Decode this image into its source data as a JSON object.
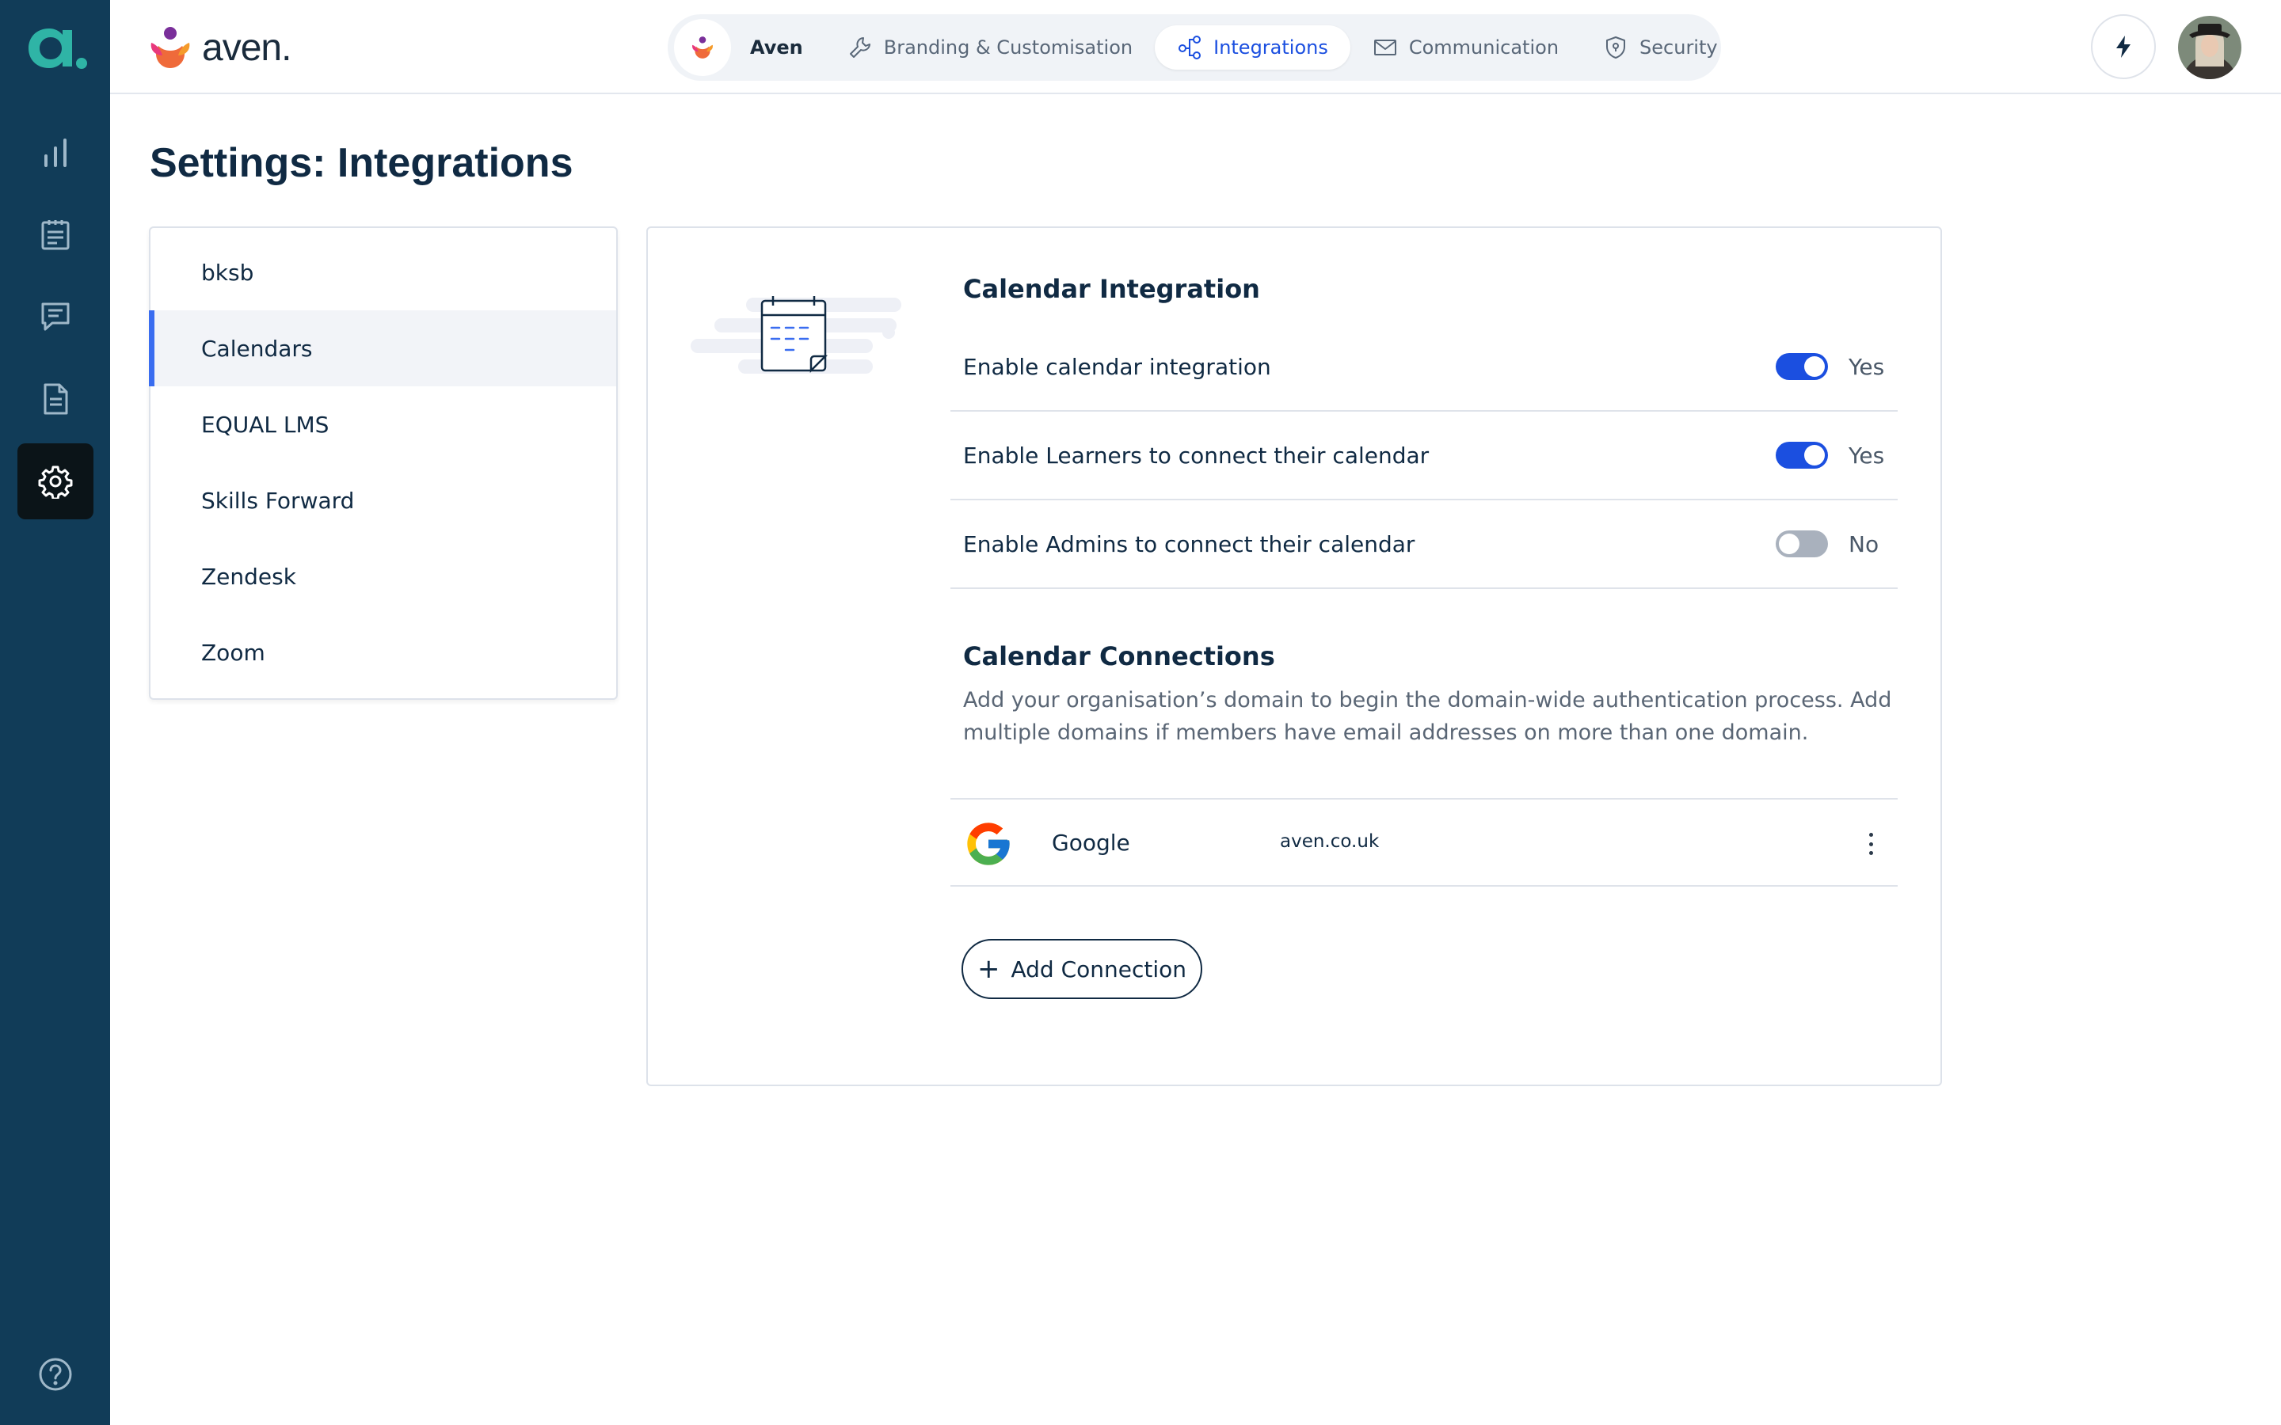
{
  "brand": {
    "name": "aven."
  },
  "nav": {
    "org_label": "Aven",
    "tabs": [
      {
        "label": "Branding & Customisation",
        "icon": "wrench-icon"
      },
      {
        "label": "Integrations",
        "icon": "integrations-icon"
      },
      {
        "label": "Communication",
        "icon": "envelope-icon"
      },
      {
        "label": "Security",
        "icon": "shield-icon"
      }
    ],
    "active_tab": "Integrations"
  },
  "rail": {
    "items": [
      "chart-icon",
      "clipboard-icon",
      "chat-icon",
      "document-icon",
      "gear-icon"
    ],
    "active": "gear-icon",
    "footer": "help-icon"
  },
  "page": {
    "title_bold": "Settings:",
    "title_rest": "Integrations"
  },
  "menu": {
    "items": [
      "bksb",
      "Calendars",
      "EQUAL LMS",
      "Skills Forward",
      "Zendesk",
      "Zoom"
    ],
    "active": "Calendars"
  },
  "calendar_integration": {
    "title": "Calendar Integration",
    "rows": [
      {
        "label": "Enable calendar integration",
        "enabled": true,
        "state": "Yes"
      },
      {
        "label": "Enable Learners to connect their calendar",
        "enabled": true,
        "state": "Yes"
      },
      {
        "label": "Enable Admins to connect their calendar",
        "enabled": false,
        "state": "No"
      }
    ]
  },
  "calendar_connections": {
    "title": "Calendar Connections",
    "description": "Add your organisation’s domain to begin the domain-wide authentication process. Add multiple domains if members have email addresses on more than one domain.",
    "connections": [
      {
        "provider": "Google",
        "domain": "aven.co.uk"
      }
    ],
    "add_button": "Add Connection"
  },
  "colors": {
    "rail": "#113c58",
    "accent": "#1b4fe0",
    "menu_active_bar": "#3a6df0",
    "text": "#102a43"
  }
}
